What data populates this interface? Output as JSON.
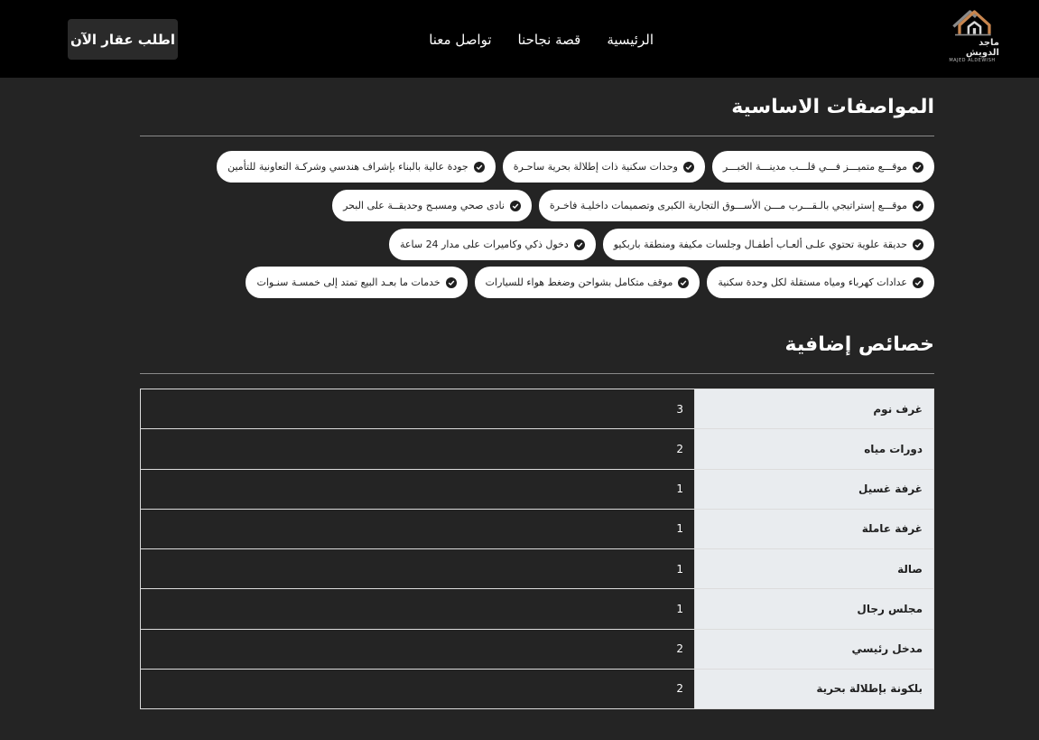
{
  "header": {
    "logo": {
      "name_ar": "ماجد الدويش",
      "name_en": "MAJED ALDEWISH"
    },
    "nav": [
      "الرئيسية",
      "قصة نجاحنا",
      "تواصل معنا"
    ],
    "cta_label": "اطلب عقار الآن"
  },
  "features": {
    "title": "المواصفات الاساسية",
    "rows": [
      [
        "موقـــع متميـــز فـــي قلـــب مدينـــة الخبـــر",
        "وحدات سكنية ذات إطلالة بحرية ساحـرة",
        "جودة عالية بالبناء بإشراف هندسي وشركـة التعاونية للتأمين"
      ],
      [
        "موقـــع إستراتيجي بالـقـــرب مـــن الأســـوق التجارية الكبرى وتصميمات داخليـة فاخـرة",
        "نادى صحي ومسبـح وحديقــة على البحر"
      ],
      [
        "حديقة علوية تحتوي علـى ألعـاب أطفـال وجلسات مكيفة ومنطقة باربكيو",
        "دخول ذكي وكاميرات على مدار 24 ساعة"
      ],
      [
        "عدادات كهرباء ومياه مستقلة لكل وحدة سكنية",
        "موقف متكامل بشواحن وضغط هواء للسيارات",
        "خدمات ما بعـد البيع تمتد إلى خمسـة سنـوات"
      ]
    ]
  },
  "extras": {
    "title": "خصائص إضافية",
    "rows": [
      {
        "label": "غرف نوم",
        "value": "3"
      },
      {
        "label": "دورات مياه",
        "value": "2"
      },
      {
        "label": "غرفة غسيل",
        "value": "1"
      },
      {
        "label": "غرفة عاملة",
        "value": "1"
      },
      {
        "label": "صالة",
        "value": "1"
      },
      {
        "label": "مجلس رجال",
        "value": "1"
      },
      {
        "label": "مدخل رئيسي",
        "value": "2"
      },
      {
        "label": "بلكونة بإطلالة بحرية",
        "value": "2"
      }
    ]
  },
  "colors": {
    "header_bg": "#000000",
    "page_bg": "#242424",
    "chip_bg": "#ffffff",
    "label_cell_bg": "#e9ecef",
    "logo_accent": "#c8864f"
  },
  "icons": {
    "check": "check-circle-icon",
    "logo": "house-logo-icon"
  }
}
